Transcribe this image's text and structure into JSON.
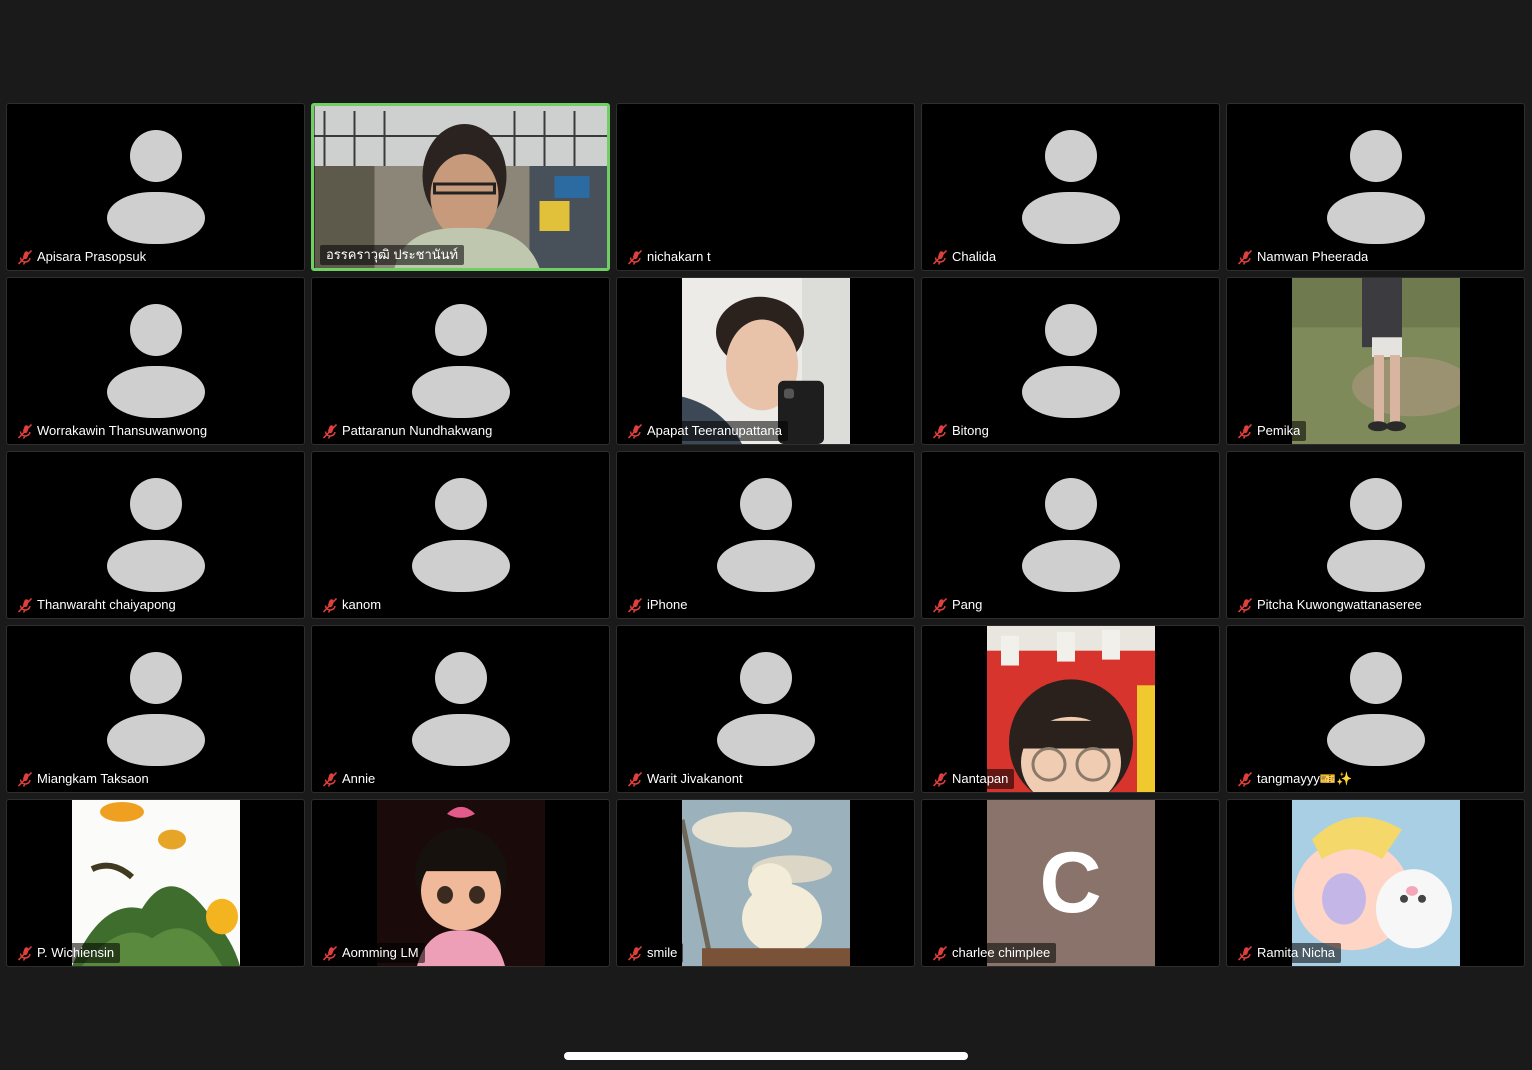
{
  "colors": {
    "background": "#1a1a1a",
    "tile": "#000000",
    "active_border": "#6fcf63",
    "muted_icon": "#e0403c",
    "avatar": "#cfcfcf"
  },
  "participants": [
    {
      "name": "Apisara Prasopsuk",
      "tile": "avatar",
      "muted": true
    },
    {
      "name": "อรรคราวุฒิ ประชานันท์",
      "tile": "video",
      "muted": false,
      "active_speaker": true
    },
    {
      "name": "nichakarn t",
      "tile": "blank",
      "muted": true
    },
    {
      "name": "Chalida",
      "tile": "avatar",
      "muted": true
    },
    {
      "name": "Namwan Pheerada",
      "tile": "avatar",
      "muted": true
    },
    {
      "name": "Worrakawin Thansuwanwong",
      "tile": "avatar",
      "muted": true
    },
    {
      "name": "Pattaranun Nundhakwang",
      "tile": "avatar",
      "muted": true
    },
    {
      "name": "Apapat Teeranupattana",
      "tile": "photo",
      "muted": true
    },
    {
      "name": "Bitong",
      "tile": "avatar",
      "muted": true
    },
    {
      "name": "Pemika",
      "tile": "photo",
      "muted": true
    },
    {
      "name": "Thanwaraht chaiyapong",
      "tile": "avatar",
      "muted": true
    },
    {
      "name": "kanom",
      "tile": "avatar",
      "muted": true
    },
    {
      "name": "iPhone",
      "tile": "avatar",
      "muted": true
    },
    {
      "name": "Pang",
      "tile": "avatar",
      "muted": true
    },
    {
      "name": "Pitcha Kuwongwattanaseree",
      "tile": "avatar",
      "muted": true
    },
    {
      "name": "Miangkam Taksaon",
      "tile": "avatar",
      "muted": true
    },
    {
      "name": "Annie",
      "tile": "avatar",
      "muted": true
    },
    {
      "name": "Warit Jivakanont",
      "tile": "avatar",
      "muted": true
    },
    {
      "name": "Nantapan",
      "tile": "photo",
      "muted": true
    },
    {
      "name": "tangmayyy🎫✨",
      "tile": "avatar",
      "muted": true
    },
    {
      "name": "P. Wichiensin",
      "tile": "photo",
      "muted": true
    },
    {
      "name": "Aomming LM",
      "tile": "photo",
      "muted": true
    },
    {
      "name": "smile",
      "tile": "photo",
      "muted": true
    },
    {
      "name": "charlee chimplee",
      "tile": "letter",
      "letter": "C",
      "muted": true
    },
    {
      "name": "Ramita Nicha",
      "tile": "photo",
      "muted": true
    }
  ]
}
